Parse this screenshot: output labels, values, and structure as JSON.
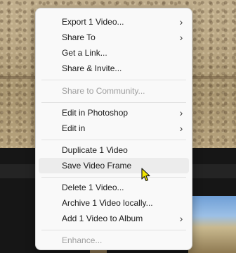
{
  "menu": {
    "items": [
      {
        "label": "Export 1 Video...",
        "submenu": true
      },
      {
        "label": "Share To",
        "submenu": true
      },
      {
        "label": "Get a Link..."
      },
      {
        "label": "Share & Invite..."
      },
      {
        "label": "Share to Community...",
        "disabled": true
      },
      {
        "label": "Edit in Photoshop",
        "submenu": true
      },
      {
        "label": "Edit in",
        "submenu": true
      },
      {
        "label": "Duplicate 1 Video"
      },
      {
        "label": "Save Video Frame",
        "hovered": true
      },
      {
        "label": "Delete 1 Video..."
      },
      {
        "label": "Archive 1 Video locally..."
      },
      {
        "label": "Add 1 Video to Album",
        "submenu": true
      },
      {
        "label": "Enhance...",
        "disabled": true
      }
    ],
    "submenu_glyph": "›"
  },
  "icons": {
    "cursor": "mouse-pointer-busy-icon"
  }
}
